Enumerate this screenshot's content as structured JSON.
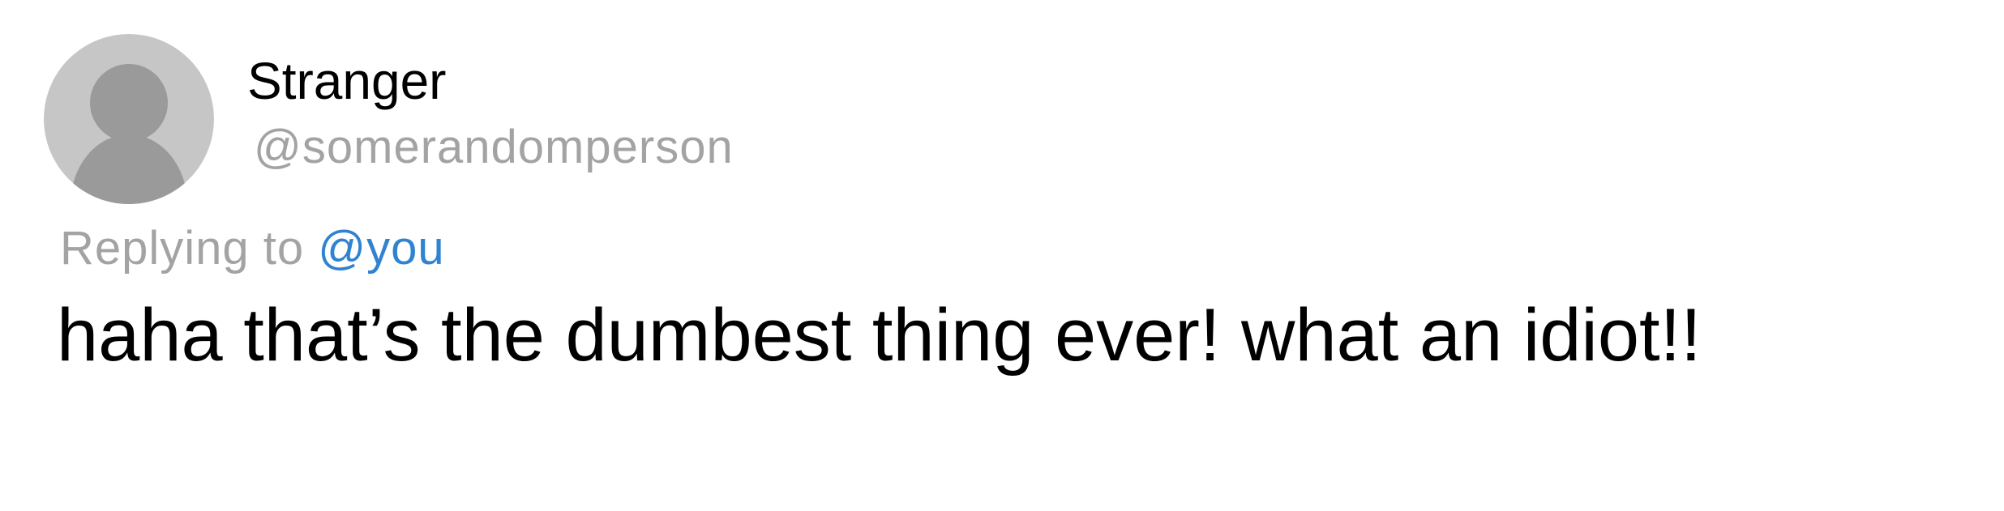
{
  "author": {
    "display_name": "Stranger",
    "handle": "@somerandomperson",
    "avatar_icon": "default-user-avatar-icon"
  },
  "reply": {
    "prefix": "Replying to ",
    "mention": "@you"
  },
  "tweet": {
    "text": "haha that’s the dumbest thing ever! what an idiot!!"
  },
  "colors": {
    "text": "#000000",
    "muted": "#a3a3a3",
    "link": "#2f83d1",
    "avatar_bg": "#c6c6c6",
    "avatar_fg": "#9a9a9a"
  }
}
